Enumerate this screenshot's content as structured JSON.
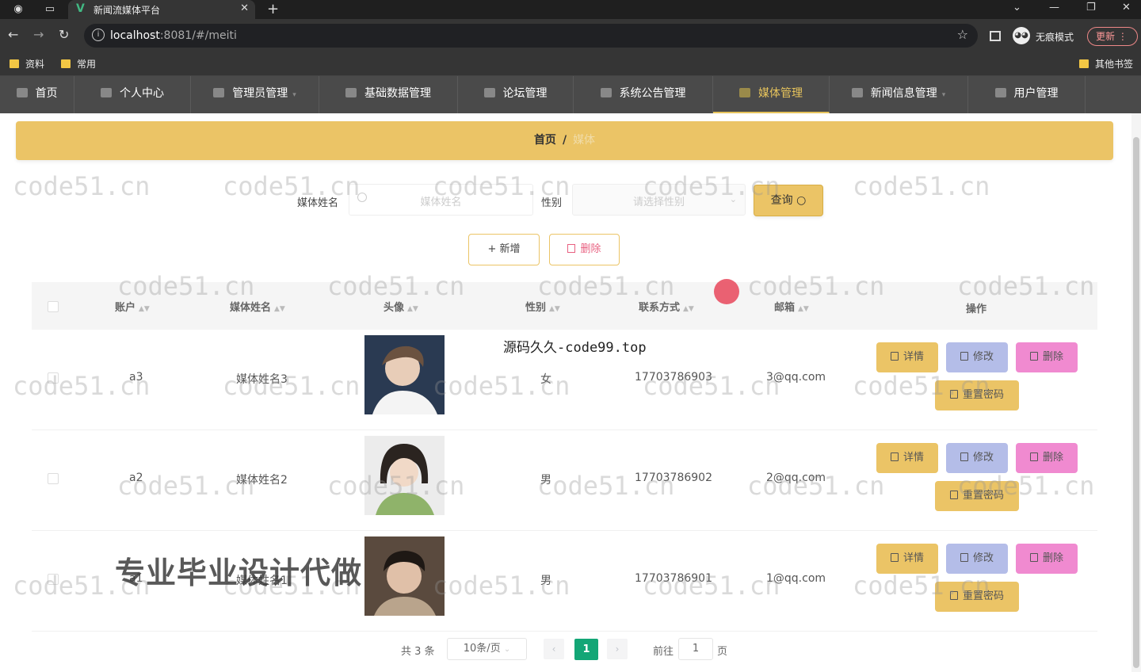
{
  "browser": {
    "tab_title": "新闻流媒体平台",
    "url_host": "localhost",
    "url_rest": ":8081/#/meiti",
    "incognito_label": "无痕模式",
    "update_label": "更新",
    "bookmarks": [
      "资料",
      "常用"
    ],
    "other_bookmarks": "其他书签"
  },
  "nav": {
    "items": [
      "首页",
      "个人中心",
      "管理员管理",
      "基础数据管理",
      "论坛管理",
      "系统公告管理",
      "媒体管理",
      "新闻信息管理",
      "用户管理"
    ],
    "active": "媒体管理"
  },
  "breadcrumb": {
    "home": "首页",
    "sep": "/",
    "current": "媒体"
  },
  "search": {
    "name_label": "媒体姓名",
    "name_placeholder": "媒体姓名",
    "gender_label": "性别",
    "gender_placeholder": "请选择性别",
    "query_label": "查询"
  },
  "actions": {
    "add_label": "+ 新增",
    "delete_label": "删除"
  },
  "table": {
    "headers": [
      "账户",
      "媒体姓名",
      "头像",
      "性别",
      "联系方式",
      "邮箱",
      "操作"
    ],
    "rows": [
      {
        "account": "a3",
        "name": "媒体姓名3",
        "gender": "女",
        "phone": "17703786903",
        "email": "3@qq.com"
      },
      {
        "account": "a2",
        "name": "媒体姓名2",
        "gender": "男",
        "phone": "17703786902",
        "email": "2@qq.com"
      },
      {
        "account": "a1",
        "name": "媒体姓名1",
        "gender": "男",
        "phone": "17703786901",
        "email": "1@qq.com"
      }
    ],
    "row_actions": {
      "detail": "详情",
      "edit": "修改",
      "delete": "删除",
      "reset": "重置密码"
    }
  },
  "pagination": {
    "total": "共 3 条",
    "page_size": "10条/页",
    "current_page": "1",
    "goto_label": "前往",
    "goto_value": "1",
    "page_unit": "页"
  },
  "overlays": {
    "watermark": "code51.cn",
    "source_text": "源码久久-code99.top",
    "ad_text": "专业毕业设计代做"
  },
  "colors": {
    "accent": "#ebc466",
    "nav_bg": "#4a4a4a",
    "pager_active": "#13a676"
  }
}
